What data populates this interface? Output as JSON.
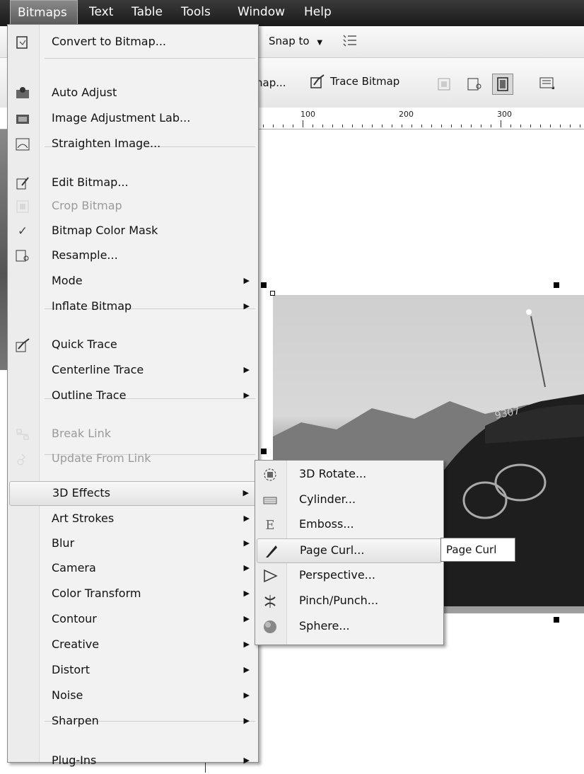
{
  "menubar": {
    "items": [
      {
        "label": "Bitmaps",
        "active": true
      },
      {
        "label": "Text"
      },
      {
        "label": "Table"
      },
      {
        "label": "Tools"
      },
      {
        "label": "Window"
      },
      {
        "label": "Help"
      }
    ]
  },
  "toolbar1": {
    "snap_label": "Snap to"
  },
  "toolbar2": {
    "bitmap_partial": "nap...",
    "trace_label": "Trace Bitmap"
  },
  "ruler": {
    "labels": [
      "100",
      "200",
      "300"
    ]
  },
  "bitmaps_menu": {
    "items": [
      {
        "label": "Convert to Bitmap...",
        "icon": "convert-bitmap-icon"
      },
      {
        "label": "Auto Adjust",
        "icon": "auto-adjust-icon"
      },
      {
        "label": "Image Adjustment Lab...",
        "icon": "image-adjustment-lab-icon"
      },
      {
        "label": "Straighten Image...",
        "icon": "straighten-image-icon"
      },
      {
        "label": "Edit Bitmap...",
        "icon": "edit-bitmap-icon"
      },
      {
        "label": "Crop Bitmap",
        "icon": "crop-bitmap-icon",
        "disabled": true
      },
      {
        "label": "Bitmap Color Mask",
        "icon": "checkmark-icon"
      },
      {
        "label": "Resample...",
        "icon": "resample-icon"
      },
      {
        "label": "Mode",
        "submenu": true
      },
      {
        "label": "Inflate Bitmap",
        "submenu": true
      },
      {
        "label": "Quick Trace",
        "icon": "quick-trace-icon"
      },
      {
        "label": "Centerline Trace",
        "submenu": true
      },
      {
        "label": "Outline Trace",
        "submenu": true
      },
      {
        "label": "Break Link",
        "icon": "break-link-icon",
        "disabled": true
      },
      {
        "label": "Update From Link",
        "icon": "update-link-icon",
        "disabled": true
      },
      {
        "label": "3D Effects",
        "submenu": true,
        "highlight": true
      },
      {
        "label": "Art Strokes",
        "submenu": true
      },
      {
        "label": "Blur",
        "submenu": true
      },
      {
        "label": "Camera",
        "submenu": true
      },
      {
        "label": "Color Transform",
        "submenu": true
      },
      {
        "label": "Contour",
        "submenu": true
      },
      {
        "label": "Creative",
        "submenu": true
      },
      {
        "label": "Distort",
        "submenu": true
      },
      {
        "label": "Noise",
        "submenu": true
      },
      {
        "label": "Sharpen",
        "submenu": true
      },
      {
        "label": "Plug-Ins",
        "submenu": true
      }
    ]
  },
  "effects_submenu": {
    "items": [
      {
        "label": "3D Rotate...",
        "icon": "3d-rotate-icon"
      },
      {
        "label": "Cylinder...",
        "icon": "cylinder-icon"
      },
      {
        "label": "Emboss...",
        "icon": "emboss-icon"
      },
      {
        "label": "Page Curl...",
        "icon": "page-curl-icon",
        "highlight": true
      },
      {
        "label": "Perspective...",
        "icon": "perspective-icon"
      },
      {
        "label": "Pinch/Punch...",
        "icon": "pinch-punch-icon"
      },
      {
        "label": "Sphere...",
        "icon": "sphere-icon"
      }
    ]
  },
  "tooltip": {
    "text": "Page Curl"
  }
}
